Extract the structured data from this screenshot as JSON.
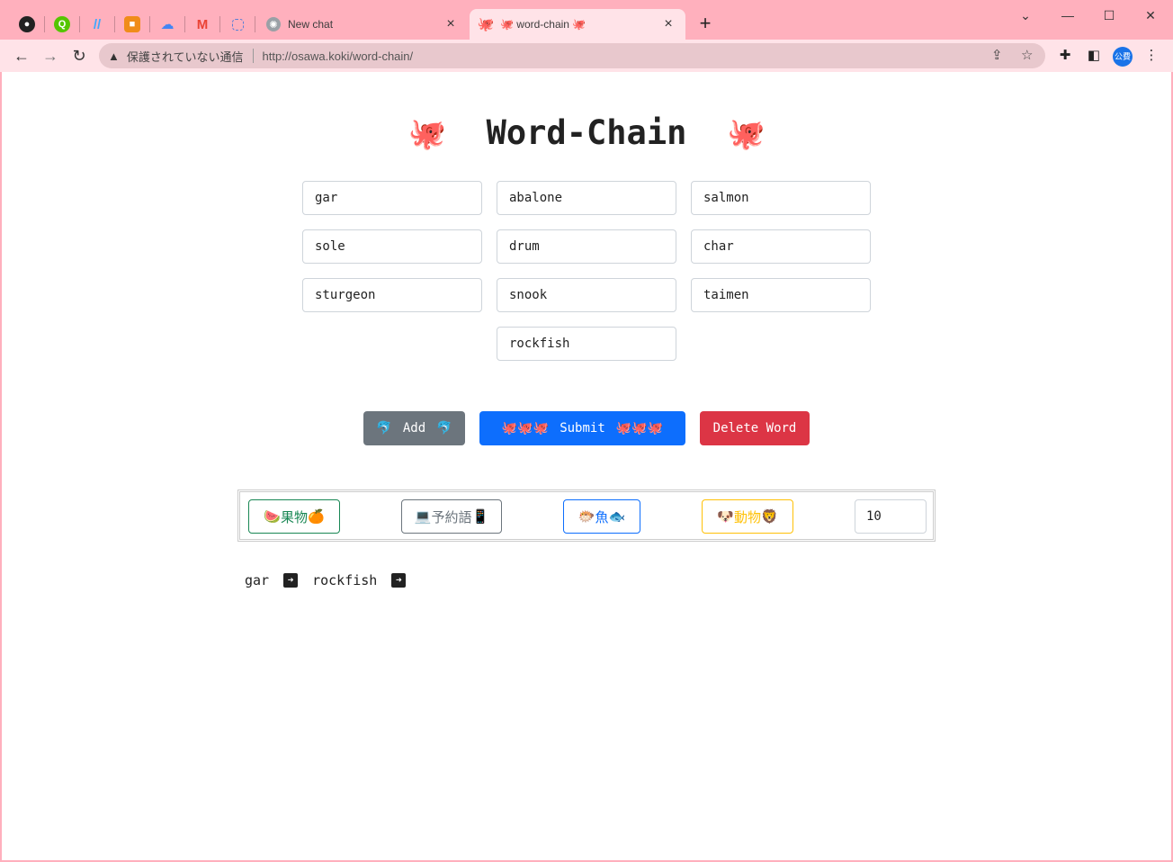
{
  "browser": {
    "tabs": [
      {
        "title": "New chat",
        "icon": "openai-icon"
      },
      {
        "title": "🐙 word-chain 🐙",
        "icon": "octopus-icon"
      }
    ],
    "pinned_icons": [
      "github-icon",
      "qiita-icon",
      "zenn-icon",
      "box-icon",
      "google-cloud-icon",
      "gmail-icon",
      "placeholder-icon"
    ],
    "address": {
      "security_label": "保護されていない通信",
      "url": "http://osawa.koki/word-chain/"
    },
    "profile_label": "公費"
  },
  "app": {
    "title": "Word-Chain",
    "title_emoji": "🐙",
    "words": [
      "gar",
      "abalone",
      "salmon",
      "sole",
      "drum",
      "char",
      "sturgeon",
      "snook",
      "taimen",
      "rockfish"
    ],
    "buttons": {
      "add": "Add",
      "add_emoji": "🐬",
      "submit": "Submit",
      "submit_emoji": "🐙🐙🐙",
      "delete": "Delete Word"
    },
    "categories": {
      "fruit": {
        "label": "果物",
        "left": "🍉",
        "right": "🍊"
      },
      "reserved": {
        "label": "予約語",
        "left": "💻",
        "right": "📱"
      },
      "fish": {
        "label": "魚",
        "left": "🐡",
        "right": "🐟"
      },
      "animal": {
        "label": "動物",
        "left": "🐶",
        "right": "🦁"
      }
    },
    "count_value": "10",
    "chain": [
      "gar",
      "rockfish"
    ]
  },
  "colors": {
    "chrome_pink": "#ffb0bd",
    "add": "#6c757d",
    "submit": "#0d6efd",
    "delete": "#dc3545",
    "fruit": "#198754",
    "fish": "#0d6efd",
    "animal": "#ffc107"
  }
}
